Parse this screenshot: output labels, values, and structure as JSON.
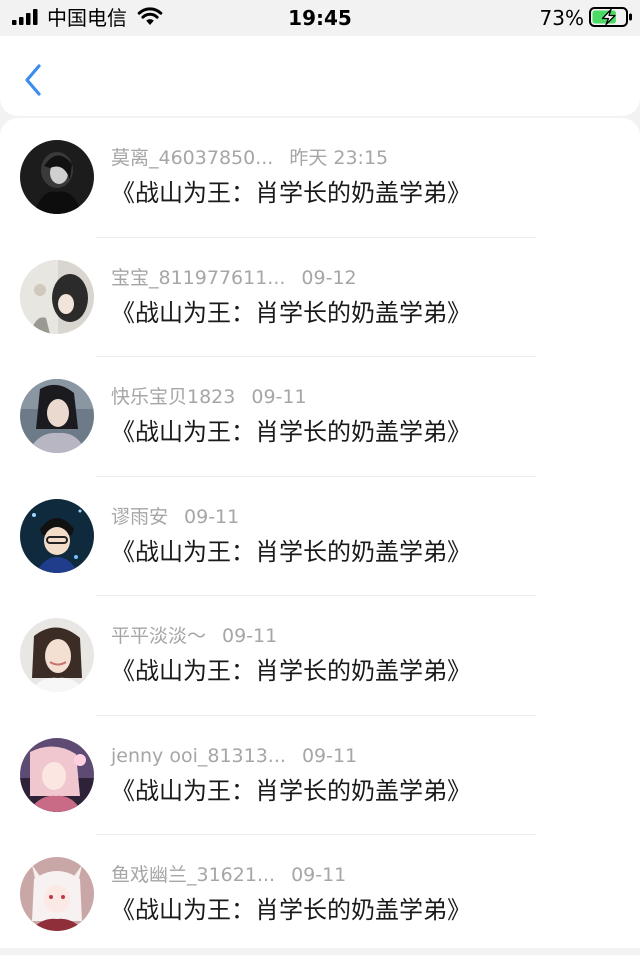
{
  "status_bar": {
    "carrier": "中国电信",
    "time": "19:45",
    "battery_percent": "73%",
    "battery_level": 0.73,
    "signal_icon": "signal-bars-icon",
    "wifi_icon": "wifi-icon",
    "battery_icon": "battery-charging-icon"
  },
  "header": {
    "back_icon": "chevron-left-icon",
    "accent_color": "#3d8cf0"
  },
  "list": {
    "items": [
      {
        "name": "莫离_46037850...",
        "time": "昨天 23:15",
        "title": "《战山为王：肖学长的奶盖学弟》"
      },
      {
        "name": "宝宝_811977611...",
        "time": "09-12",
        "title": "《战山为王：肖学长的奶盖学弟》"
      },
      {
        "name": "快乐宝贝1823",
        "time": "09-11",
        "title": "《战山为王：肖学长的奶盖学弟》"
      },
      {
        "name": "谬雨安",
        "time": "09-11",
        "title": "《战山为王：肖学长的奶盖学弟》"
      },
      {
        "name": "平平淡淡～",
        "time": "09-11",
        "title": "《战山为王：肖学长的奶盖学弟》"
      },
      {
        "name": "jenny ooi_81313...",
        "time": "09-11",
        "title": "《战山为王：肖学长的奶盖学弟》"
      },
      {
        "name": "鱼戏幽兰_31621...",
        "time": "09-11",
        "title": "《战山为王：肖学长的奶盖学弟》"
      }
    ]
  }
}
